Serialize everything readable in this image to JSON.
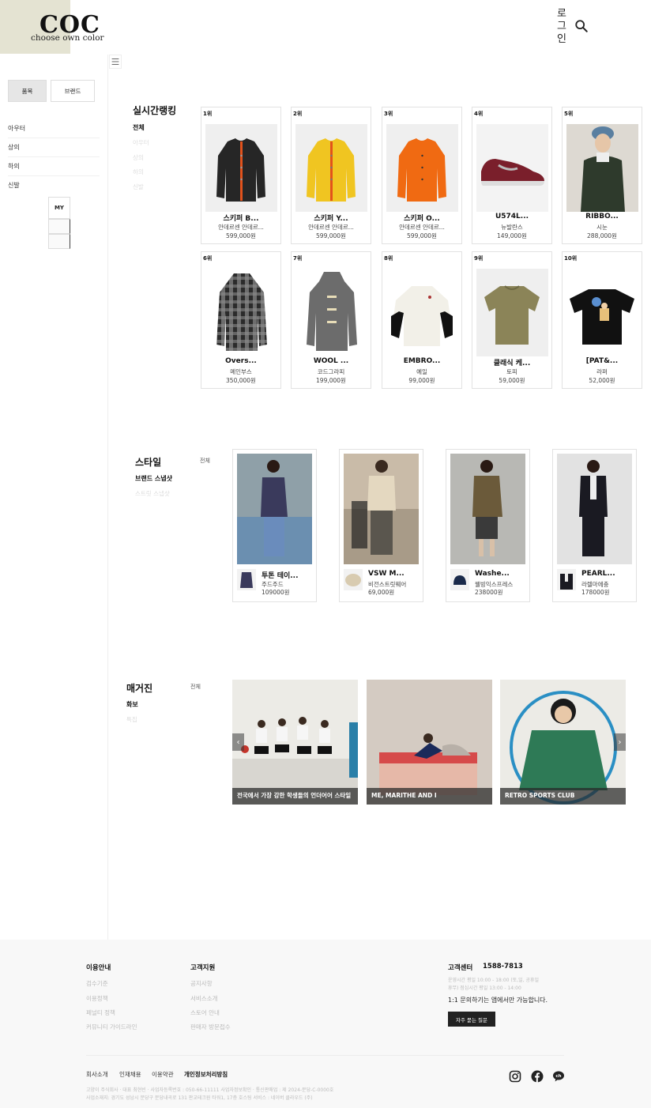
{
  "header": {
    "logo_main": "COC",
    "logo_sub": "choose own color",
    "login_label": "로\n그\n인"
  },
  "sidebar": {
    "tab_category": "품목",
    "tab_brand": "브랜드",
    "categories": [
      "아우터",
      "상의",
      "하의",
      "신발"
    ],
    "my_label": "MY"
  },
  "ranking": {
    "title": "실시간랭킹",
    "subcats": [
      "전체",
      "아우터",
      "상의",
      "하의",
      "신발"
    ],
    "items": [
      {
        "rank": "1위",
        "name": "스키퍼 B...",
        "brand": "안데르센 안데르...",
        "price": "599,000원"
      },
      {
        "rank": "2위",
        "name": "스키퍼 Y...",
        "brand": "안데르센 안데르...",
        "price": "599,000원"
      },
      {
        "rank": "3위",
        "name": "스키퍼 O...",
        "brand": "안데르센 안데르...",
        "price": "599,000원"
      },
      {
        "rank": "4위",
        "name": "U574L...",
        "brand": "뉴발란스",
        "price": "149,000원"
      },
      {
        "rank": "5위",
        "name": "RIBBO...",
        "brand": "시눈",
        "price": "288,000원"
      },
      {
        "rank": "6위",
        "name": "Overs...",
        "brand": "메인부스",
        "price": "350,000원"
      },
      {
        "rank": "7위",
        "name": "WOOL ...",
        "brand": "코드그라피",
        "price": "199,000원"
      },
      {
        "rank": "8위",
        "name": "EMBRO...",
        "brand": "예일",
        "price": "99,000원"
      },
      {
        "rank": "9위",
        "name": "클래식 케...",
        "brand": "토피",
        "price": "59,000원"
      },
      {
        "rank": "10위",
        "name": "[PAT&...",
        "brand": "라퍼",
        "price": "52,000원"
      }
    ]
  },
  "style": {
    "title": "스타일",
    "all": "전체",
    "subcats": [
      "브랜드 스냅샷",
      "스트릿 스냅샷"
    ],
    "items": [
      {
        "name": "투톤 테이...",
        "brand": "주드주드",
        "price": "109000원"
      },
      {
        "name": "VSW M...",
        "brand": "비전스트릿웨어",
        "price": "69,000원"
      },
      {
        "name": "Washe...",
        "brand": "웰빙익스프레스",
        "price": "238000원"
      },
      {
        "name": "PEARL...",
        "brand": "라렐마에충",
        "price": "178000원"
      }
    ]
  },
  "magazine": {
    "title": "매거진",
    "all": "전체",
    "subcats": [
      "화보",
      "특집"
    ],
    "items": [
      {
        "caption": "전국에서 가장 강한 학생들의 언더어어 스타일"
      },
      {
        "caption": "ME, MARITHE AND I"
      },
      {
        "caption": "RETRO SPORTS CLUB"
      }
    ]
  },
  "footer": {
    "col1_title": "이용안내",
    "col1_links": [
      "검수기준",
      "이용정책",
      "페널티 정책",
      "커뮤니티 가이드라인"
    ],
    "col2_title": "고객지원",
    "col2_links": [
      "공지사항",
      "서비스소개",
      "스토어 안내",
      "판매자 방문접수"
    ],
    "cs_title": "고객센터",
    "cs_phone": "1588-7813",
    "cs_hours1": "운영시간 평일 10:00 - 18:00 (토,일, 공휴일",
    "cs_hours2": "휴무) 점심시간 평일 13:00 - 14:00",
    "cs_notice": "1:1 문의하기는 앱에서만 가능합니다.",
    "faq_button": "자주 묻는 질문",
    "bottom_links": [
      "회사소개",
      "인재채용",
      "이용약관",
      "개인정보처리방침"
    ],
    "company_info1": "고양이 주식회사 · 대표 최현빈 · 사업자등록번호 : 050-66-11111 사업자정보확인 · 통신판매업 : 제 2024-분당-C-0000호",
    "company_info2": "사업소재지: 경기도 성남시 분당구 분당내곡로 131 판교테크원 타워1, 17층 호스팅 서비스 : 네이버 클라우드 (주)"
  },
  "colors": {
    "logo_bg": "#e4e3d2",
    "footer_bg": "#f8f8f8",
    "button_dark": "#222222"
  }
}
